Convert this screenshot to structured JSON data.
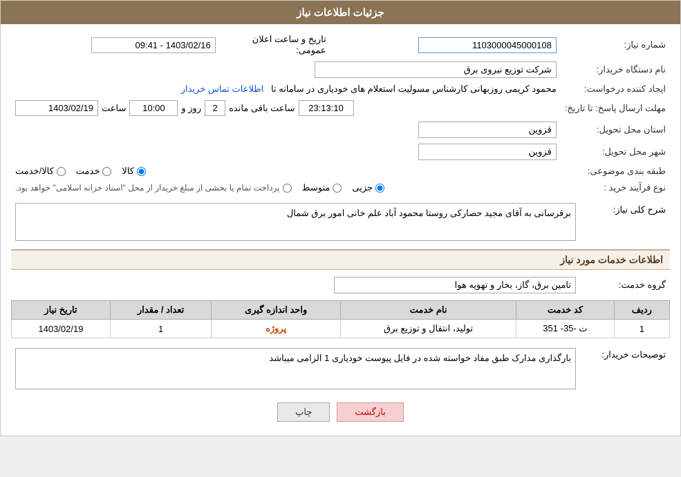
{
  "header": {
    "title": "جزئیات اطلاعات نیاز"
  },
  "fields": {
    "need_number_label": "شماره نیاز:",
    "need_number_value": "1103000045000108",
    "org_name_label": "نام دستگاه خریدار:",
    "org_name_value": "شرکت توزیع نیروی برق",
    "creator_label": "ایجاد کننده درخواست:",
    "creator_value": "محمود کریمی روزبهانی کارشناس  مسولیت استعلام های خودیاری در سامانه تا",
    "creator_link": "اطلاعات تماس خریدار",
    "date_label": "تاریخ و ساعت اعلان عمومی:",
    "date_value": "1403/02/16 - 09:41",
    "deadline_label": "مهلت ارسال پاسخ: تا تاریخ:",
    "deadline_date": "1403/02/19",
    "deadline_time_label": "ساعت",
    "deadline_time": "10:00",
    "deadline_days_label": "روز و",
    "deadline_days": "2",
    "deadline_remaining_label": "ساعت باقی مانده",
    "deadline_remaining": "23:13:10",
    "province_label": "استان محل تحویل:",
    "province_value": "قزوین",
    "city_label": "شهر محل تحویل:",
    "city_value": "قزوین",
    "category_label": "طبقه بندی موضوعی:",
    "category_options": [
      {
        "label": "کالا",
        "value": "kala",
        "selected": true
      },
      {
        "label": "خدمت",
        "value": "khedmat"
      },
      {
        "label": "کالا/خدمت",
        "value": "kala_khedmat"
      }
    ],
    "process_label": "نوع فرآیند خرید :",
    "process_options": [
      {
        "label": "جزیی",
        "value": "jozi"
      },
      {
        "label": "متوسط",
        "value": "motevaset"
      },
      {
        "label": "پرداخت تمام یا بخشی از مبلغ خریدار از محل \"اسناد خزانه اسلامی\" خواهد بود.",
        "value": "other"
      }
    ]
  },
  "narration": {
    "title": "شرح کلی نیاز:",
    "value": "برقرسانی به آقای مجید حصارکی روستا محمود آباد علم خانی امور برق شمال"
  },
  "services_section": {
    "title": "اطلاعات خدمات مورد نیاز",
    "service_group_label": "گروه خدمت:",
    "service_group_value": "تامین برق، گاز، بخار و تهویه هوا",
    "table": {
      "headers": [
        "ردیف",
        "کد خدمت",
        "نام خدمت",
        "واحد اندازه گیری",
        "تعداد / مقدار",
        "تاریخ نیاز"
      ],
      "rows": [
        {
          "row": "1",
          "code": "ت -35- 351",
          "name": "تولید، انتقال و توزیع برق",
          "unit": "پروژه",
          "count": "1",
          "date": "1403/02/19"
        }
      ]
    }
  },
  "buyer_desc": {
    "label": "توصیحات خریدار:",
    "value": "بارگذاری مدارک طبق مفاد خواسته شده در فایل پیوست خودیاری 1 الزامی میباشد"
  },
  "buttons": {
    "print": "چاپ",
    "back": "بازگشت"
  }
}
